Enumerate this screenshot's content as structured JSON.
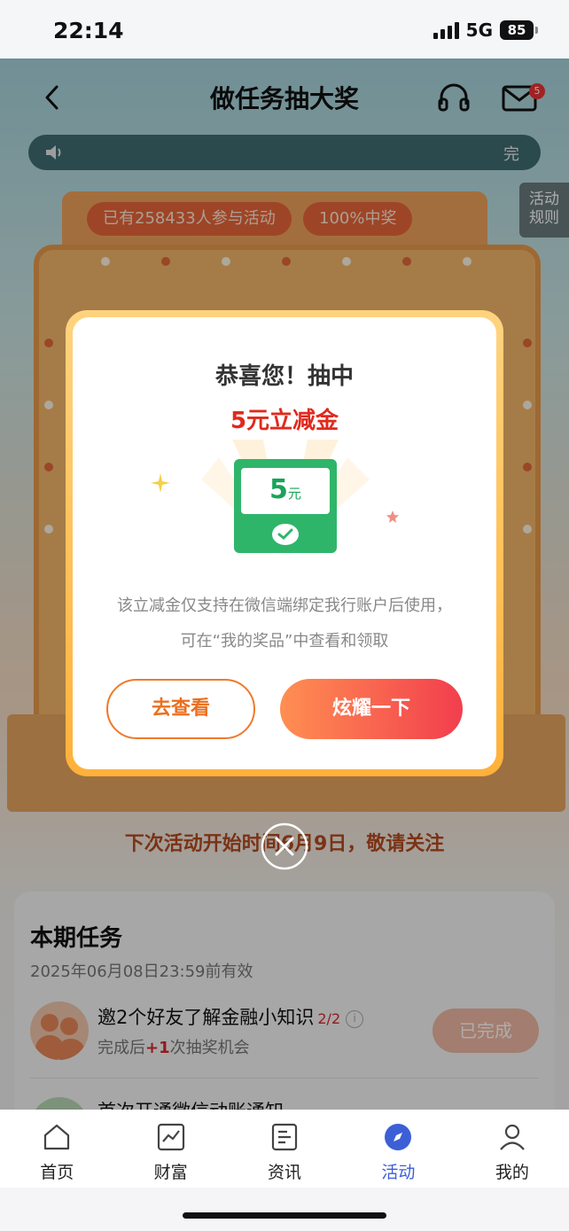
{
  "status_bar": {
    "time": "22:14",
    "network": "5G",
    "battery": "85"
  },
  "header": {
    "title": "做任务抽大奖",
    "mail_badge": "5"
  },
  "marquee": {
    "text": "完"
  },
  "rules_tab": {
    "line1": "活动",
    "line2": "规则"
  },
  "machine": {
    "participants": "已有258433人参与活动",
    "win_rate": "100%中奖"
  },
  "notice": "下次活动开始时间6月9日，敬请关注",
  "tasks": {
    "title": "本期任务",
    "valid_until": "2025年06月08日23:59前有效",
    "items": [
      {
        "name": "邀2个好友了解金融小知识",
        "progress": "2/2",
        "desc_prefix": "完成后",
        "desc_plus": "+1",
        "desc_suffix": "次抽奖机会",
        "button": "已完成"
      },
      {
        "name": "首次开通微信动账通知"
      }
    ]
  },
  "modal": {
    "title": "恭喜您！抽中",
    "prize": "5元立减金",
    "coupon_amount": "5",
    "coupon_unit": "元",
    "note_line1": "该立减金仅支持在微信端绑定我行账户后使用，",
    "note_line2": "可在“我的奖品”中查看和领取",
    "view_button": "去查看",
    "share_button": "炫耀一下"
  },
  "tabbar": {
    "items": [
      {
        "label": "首页",
        "icon": "home-icon"
      },
      {
        "label": "财富",
        "icon": "chart-icon"
      },
      {
        "label": "资讯",
        "icon": "news-icon"
      },
      {
        "label": "活动",
        "icon": "compass-icon",
        "active": true
      },
      {
        "label": "我的",
        "icon": "user-icon"
      }
    ]
  },
  "colors": {
    "accent_blue": "#3c5fd6",
    "prize_red": "#e02a1d",
    "share_gradient_start": "#ff8f52",
    "share_gradient_end": "#f23e4d",
    "coupon_green": "#2fb56a"
  }
}
